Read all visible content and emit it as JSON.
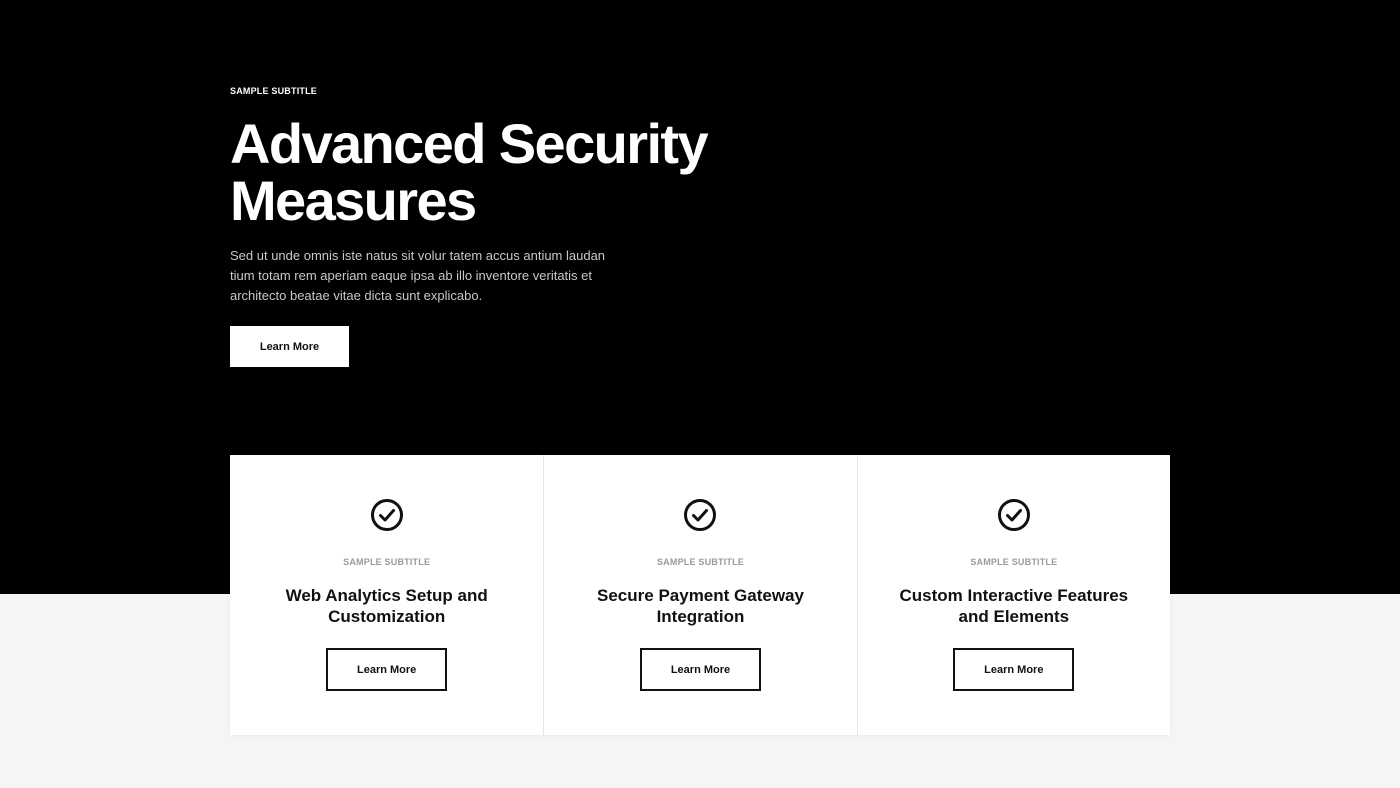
{
  "hero": {
    "subtitle": "SAMPLE SUBTITLE",
    "title_line1": "Advanced Security",
    "title_line2": "Measures",
    "description": "Sed ut unde omnis iste natus sit volur tatem accus antium laudan tium totam rem aperiam eaque ipsa ab illo inventore veritatis et architecto beatae vitae dicta sunt explicabo.",
    "button_label": "Learn More"
  },
  "cards": [
    {
      "icon": "check-circle-icon",
      "subtitle": "SAMPLE SUBTITLE",
      "title": "Web Analytics Setup and Customization",
      "button_label": "Learn More"
    },
    {
      "icon": "check-circle-icon",
      "subtitle": "SAMPLE SUBTITLE",
      "title": "Secure Payment Gateway Integration",
      "button_label": "Learn More"
    },
    {
      "icon": "check-circle-icon",
      "subtitle": "SAMPLE SUBTITLE",
      "title": "Custom Interactive Features and Elements",
      "button_label": "Learn More"
    }
  ],
  "colors": {
    "hero_background": "#000000",
    "page_background": "#f5f5f5",
    "card_background": "#ffffff",
    "text_dark": "#111111",
    "text_muted": "#9a9a9a"
  }
}
